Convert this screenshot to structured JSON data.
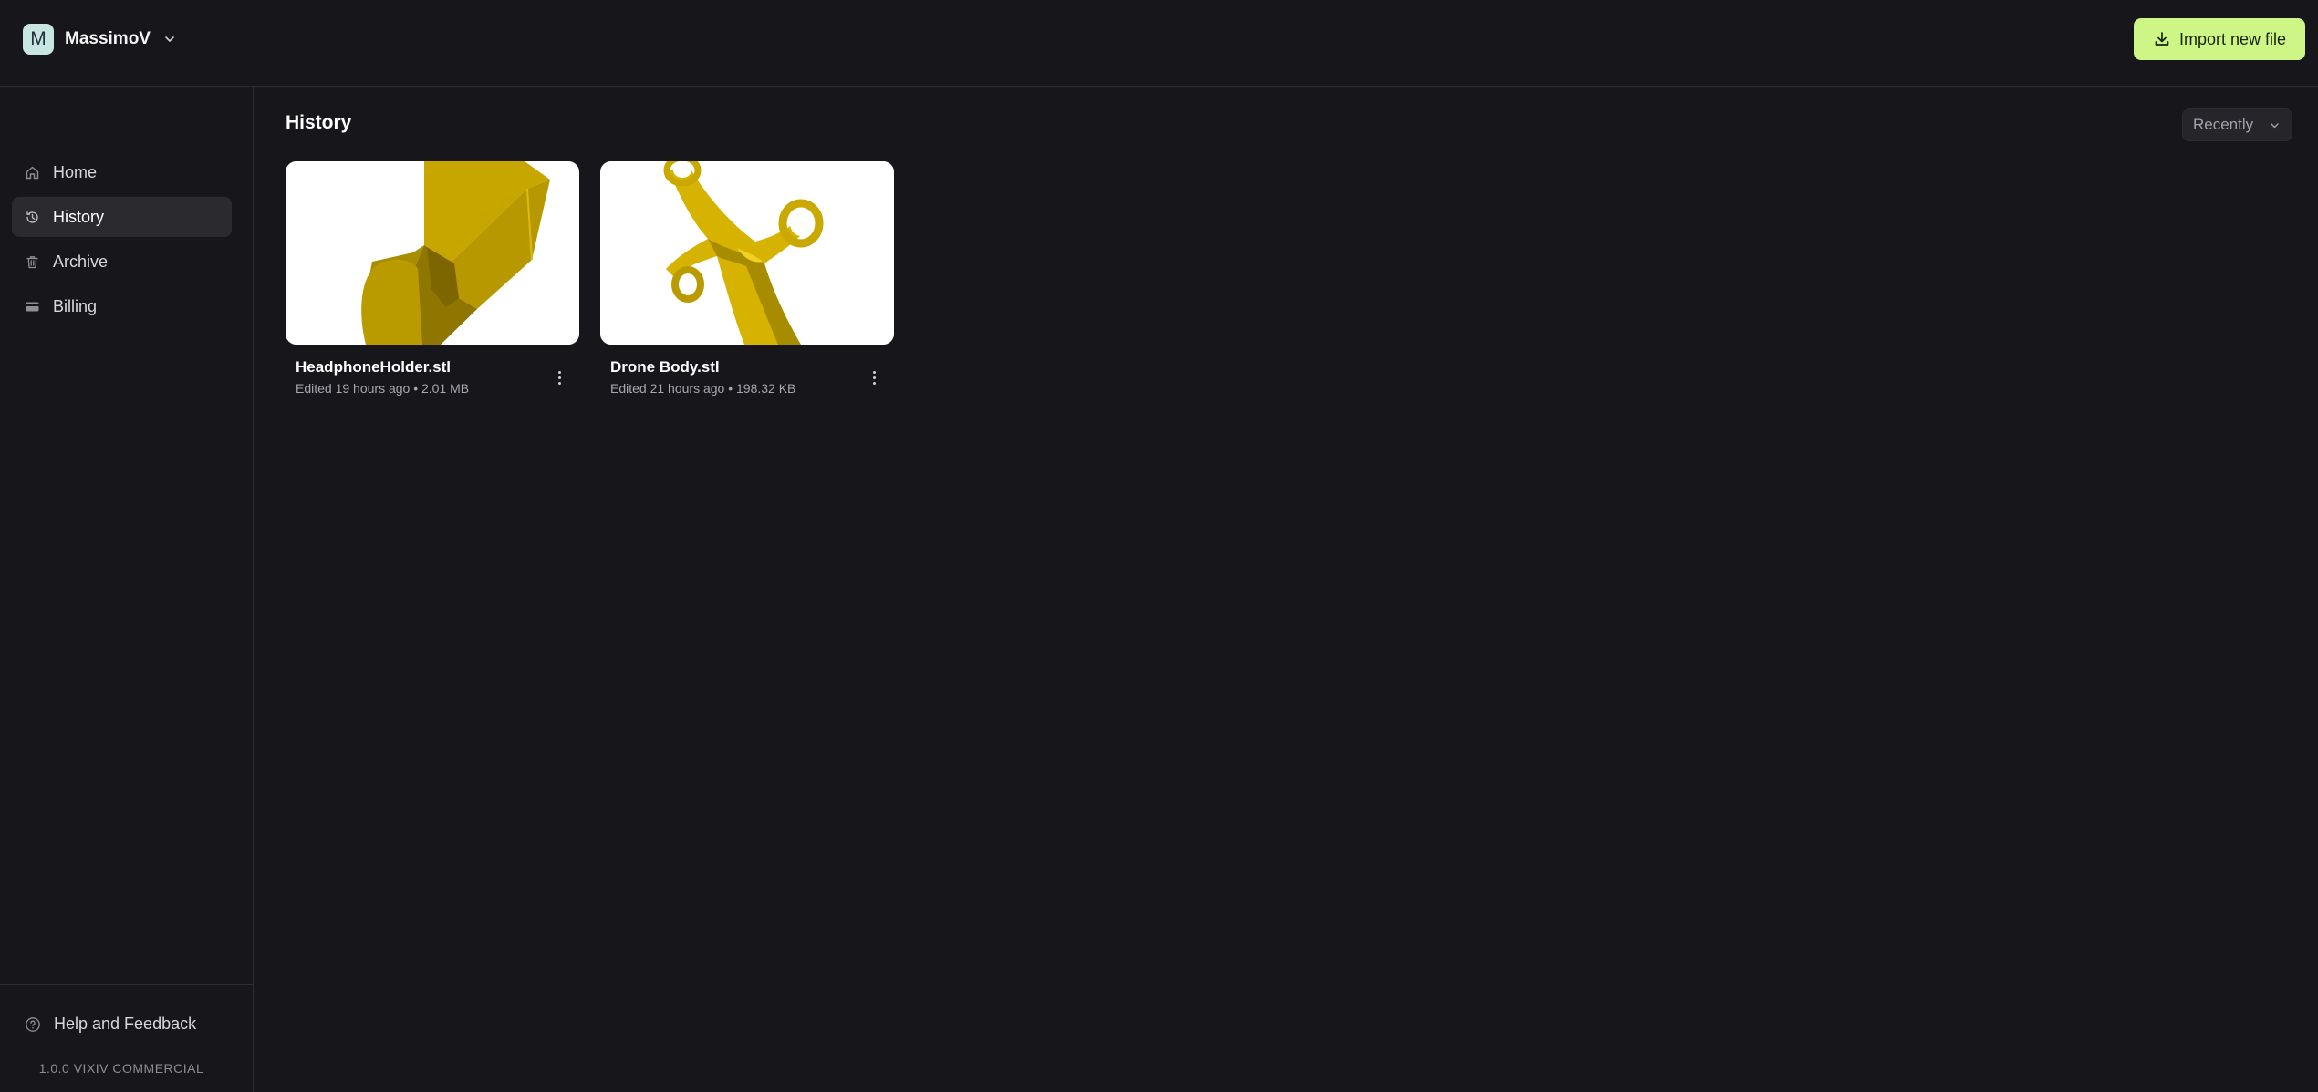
{
  "account": {
    "initial": "M",
    "name": "MassimoV"
  },
  "header": {
    "import_label": "Import new file"
  },
  "sidebar": {
    "items": [
      {
        "label": "Home",
        "icon": "home-icon",
        "active": false
      },
      {
        "label": "History",
        "icon": "history-icon",
        "active": true
      },
      {
        "label": "Archive",
        "icon": "trash-icon",
        "active": false
      },
      {
        "label": "Billing",
        "icon": "credit-card-icon",
        "active": false
      }
    ],
    "help_label": "Help and Feedback",
    "version": "1.0.0 VIXIV COMMERCIAL"
  },
  "main": {
    "title": "History",
    "sort": {
      "selected": "Recently"
    },
    "files": [
      {
        "name": "HeadphoneHolder.stl",
        "info": "Edited 19 hours ago • 2.01 MB"
      },
      {
        "name": "Drone Body.stl",
        "info": "Edited 21 hours ago • 198.32 KB"
      }
    ]
  },
  "colors": {
    "background": "#17171b",
    "accent": "#cdf686",
    "model_yellow": "#c9a800"
  }
}
